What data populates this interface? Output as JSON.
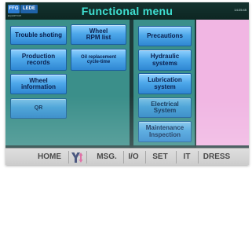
{
  "header": {
    "logo_ffg": "FFG",
    "logo_brand": "LEDE",
    "logo_sub": "EQUIPTOP",
    "title": "Functional menu",
    "clock": "14:25:45"
  },
  "left_panel": {
    "trouble_shooting": "Trouble shoting",
    "wheel_rpm": "Wheel\nRPM list",
    "production_records": "Production\nrecords",
    "oil_replacement": "Oil replacement\ncycle-time",
    "wheel_information": "Wheel\ninformation",
    "qr": "QR"
  },
  "mid_panel": {
    "precautions": "Precautions",
    "hydraulic": "Hydraulic\nsystems",
    "lubrication": "Lubrication\nsystem",
    "electrical": "Electrical\nSystem",
    "maintenance": "Maintenance\nInspection"
  },
  "navbar": {
    "home": "HOME",
    "y_icon": "Y-axis-arrows-icon",
    "msg": "MSG.",
    "io": "I/O",
    "set": "SET",
    "it": "IT",
    "dress": "DRESS"
  },
  "colors": {
    "panel_teal": "#3b8f8a",
    "header_text": "#3fe0d2",
    "pink_panel": "#f1b6e3",
    "button_blue": "#4ea8ea"
  }
}
